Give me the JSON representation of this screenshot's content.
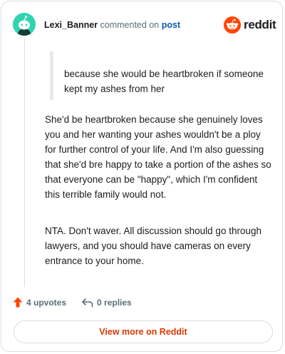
{
  "header": {
    "username": "Lexi_Banner",
    "action_text": "commented on",
    "post_link": "post",
    "brand_name": "reddit"
  },
  "comment": {
    "quote": "because she would be heartbroken if someone kept my ashes from her",
    "paragraphs": [
      "She'd be heartbroken because she genuinely loves you and her wanting your ashes wouldn't be a ploy for further control of your life. And I'm also guessing that she'd bre happy to take a portion of the ashes so that everyone can be \"happy\", which I'm confident this terrible family would not.",
      "NTA. Don't waver. All discussion should go through lawyers, and you should have cameras on every entrance to your home."
    ]
  },
  "footer": {
    "upvotes": "4 upvotes",
    "replies": "0 replies",
    "view_more": "View more on Reddit"
  },
  "icons": {
    "avatar": "snoo-avatar-icon",
    "logo": "reddit-logo-icon",
    "upvote": "upvote-arrow-icon",
    "reply": "reply-arrow-icon"
  },
  "colors": {
    "brand": "#ff4500",
    "avatar_bg": "#30d5b0",
    "link": "#0a5db6",
    "view_more_text": "#d93900"
  }
}
